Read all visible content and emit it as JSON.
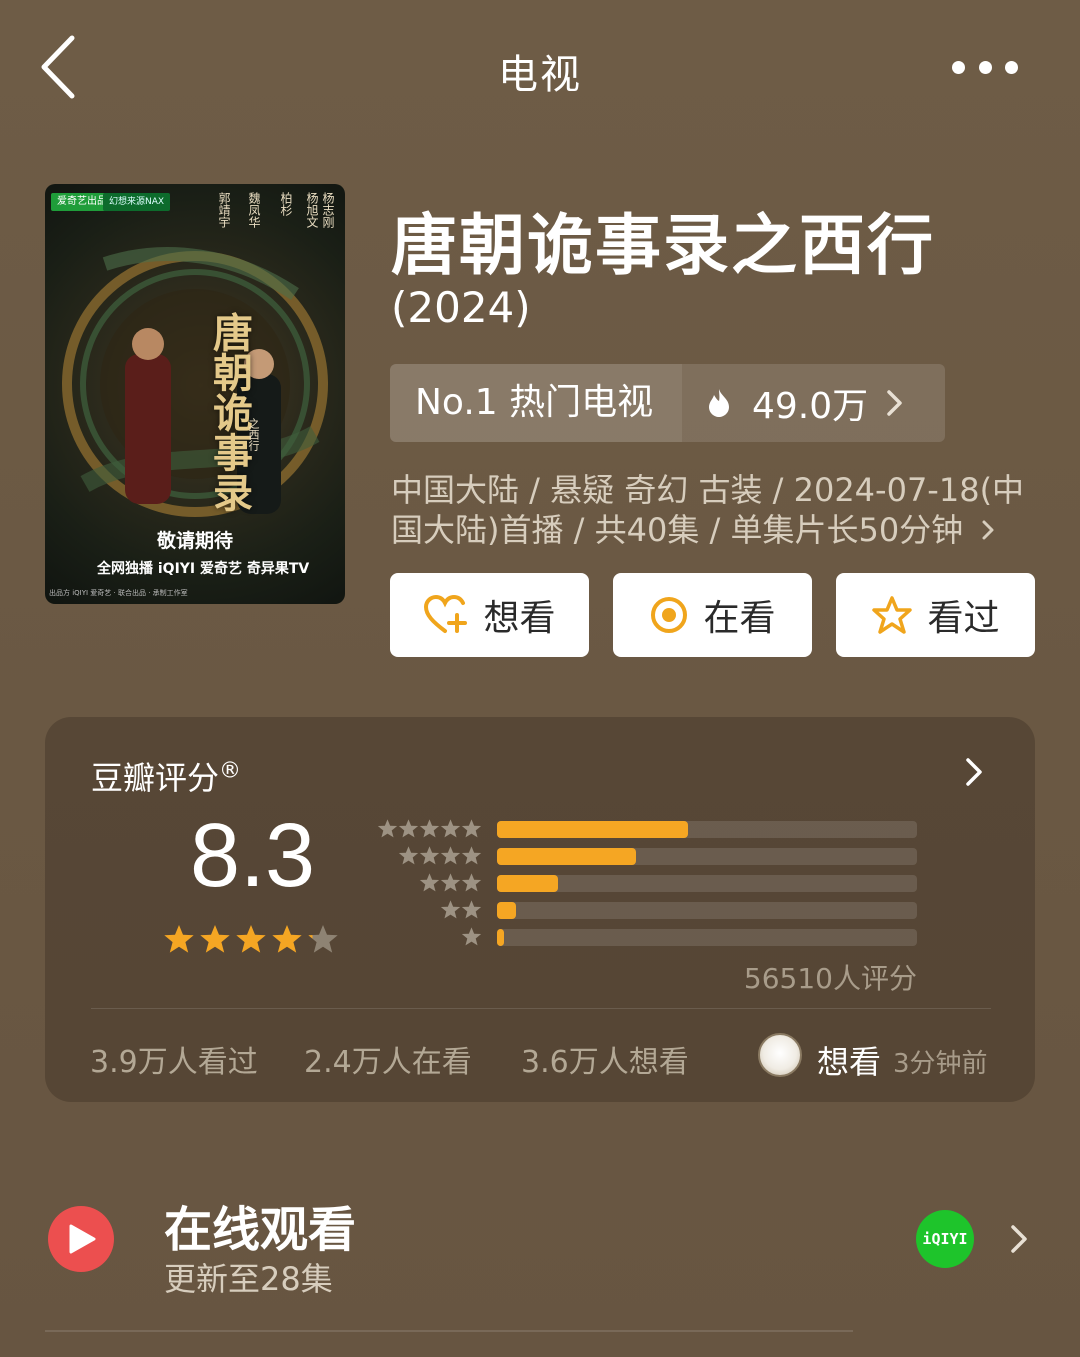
{
  "nav": {
    "title": "电视",
    "back_icon": "chevron-left-icon",
    "more_icon": "more-dots-icon"
  },
  "poster": {
    "badge": "爱奇艺出品",
    "badge2": "幻想来源NAX",
    "cast": [
      "杨志刚",
      "杨旭文",
      "柏杉",
      "魏凤华",
      "郭靖宇"
    ],
    "calligraphy": "唐朝诡事录",
    "subtitle": "之西行",
    "stay_tuned": "敬请期待",
    "platform": "全网独播 iQIYI 爱奇艺 奇异果TV",
    "credits": "出品方 iQIYI 爱奇艺 · 联合出品 · 承制工作室"
  },
  "show": {
    "title": "唐朝诡事录之西行",
    "year": "(2024)",
    "rank_label": "No.1 热门电视",
    "heat": "49.0万",
    "meta": "中国大陆 / 悬疑 奇幻 古装 / 2024-07-18(中国大陆)首播 / 共40集 / 单集片长50分钟"
  },
  "actions": {
    "want": "想看",
    "watching": "在看",
    "watched": "看过"
  },
  "rating": {
    "title": "豆瓣评分",
    "registered": "®",
    "score": "8.3",
    "stars": 4.15,
    "distribution": [
      {
        "stars": 5,
        "fraction": 0.455
      },
      {
        "stars": 4,
        "fraction": 0.33
      },
      {
        "stars": 3,
        "fraction": 0.145
      },
      {
        "stars": 2,
        "fraction": 0.045
      },
      {
        "stars": 1,
        "fraction": 0.016
      }
    ],
    "count": "56510人评分",
    "watched": "3.9万人看过",
    "watching": "2.4万人在看",
    "want": "3.6万人想看",
    "friend_action": "想看",
    "friend_time": "3分钟前"
  },
  "online": {
    "title": "在线观看",
    "subtitle": "更新至28集",
    "platform_icon": "iqiyi-icon",
    "platform_label": "iQIYI"
  },
  "colors": {
    "accent": "#f5a623",
    "play": "#ec4f4f",
    "iqiyi": "#1ec42b"
  }
}
